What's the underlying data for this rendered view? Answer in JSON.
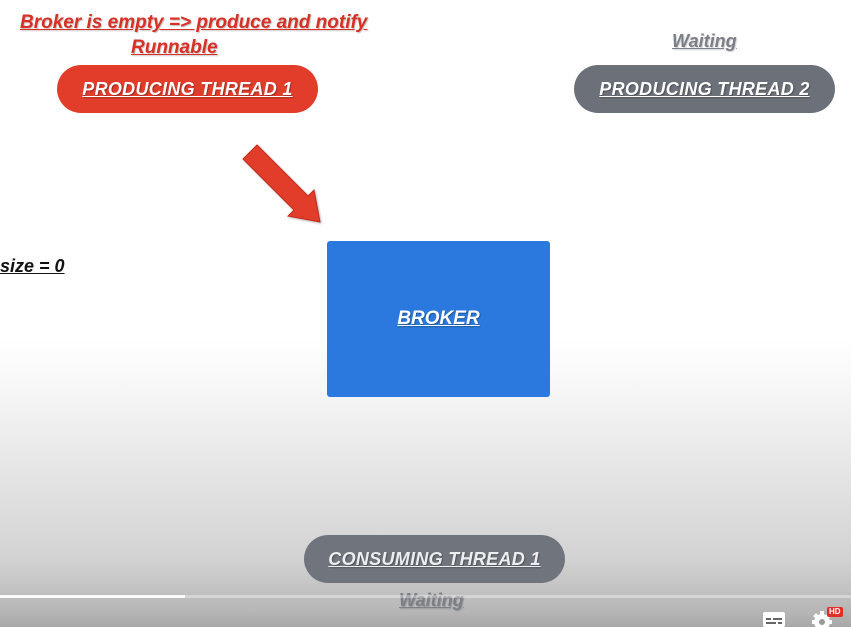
{
  "header": {
    "status_line": "Broker is empty => produce and notify",
    "producer1_state": "Runnable",
    "producer2_state": "Waiting",
    "consumer1_state": "Waiting"
  },
  "threads": {
    "producer1": "PRODUCING  THREAD  1",
    "producer2": "PRODUCING  THREAD  2",
    "consumer1": "CONSUMING  THREAD  1"
  },
  "broker": {
    "label": "BROKER",
    "size_label": "size = 0"
  },
  "player": {
    "progress": 0.217,
    "hd_badge": "HD"
  },
  "colors": {
    "red": "#e23c2a",
    "gray": "#6c7079",
    "blue": "#2b79de"
  }
}
